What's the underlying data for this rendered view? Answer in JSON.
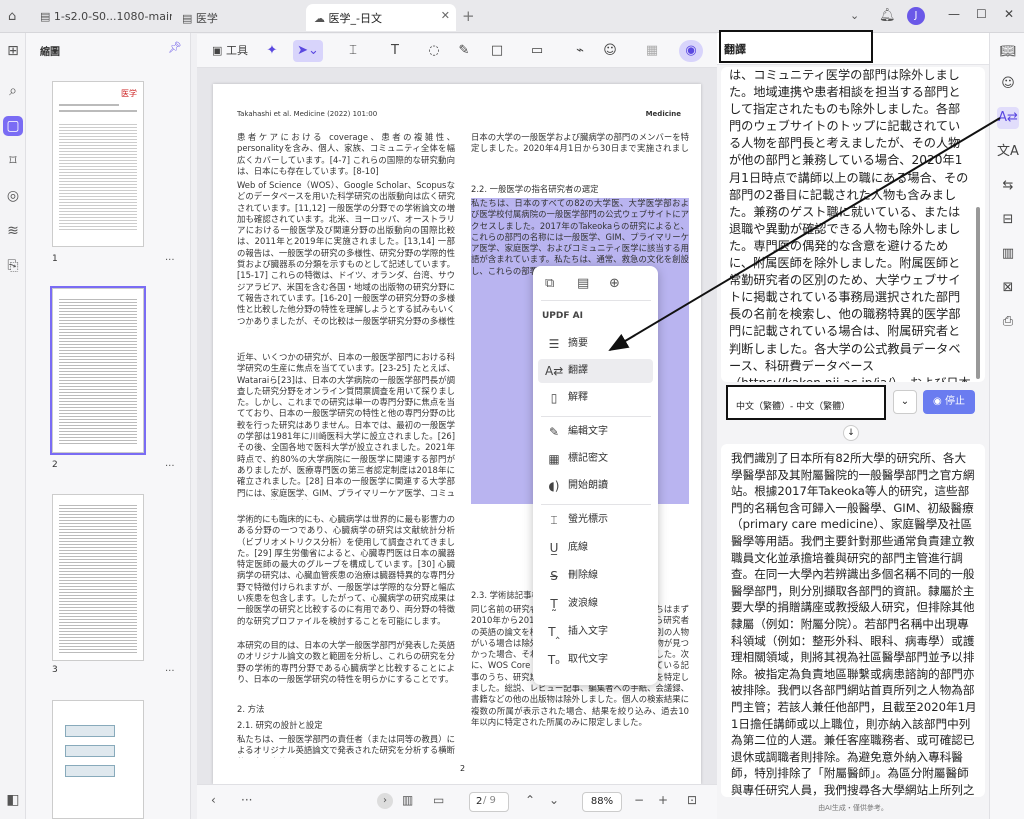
{
  "tabs": [
    {
      "label": "1-s2.0-S0...1080-main"
    },
    {
      "label": "医学"
    },
    {
      "label": "医学_-日文"
    }
  ],
  "window": {
    "avatar": "J"
  },
  "thumbnails": {
    "header": "縮圖",
    "pages": [
      {
        "num": "1"
      },
      {
        "num": "2"
      },
      {
        "num": "3"
      }
    ],
    "more": "..."
  },
  "toolbar": {
    "tools_label": "工具"
  },
  "document": {
    "header_left": "Takahashi et al. Medicine (2022) 101:00",
    "header_right": "Medicine",
    "col_left": [
      "患者ケアにおける coverage、患者の複雑性、personalityを含み、個人、家族、コミュニティ全体を幅広くカバーしています。[4-7] これらの国際的な研究動向は、日本にも存在しています。[8-10]",
      "Web of Science（WOS）、Google Scholar、Scopusなどのデータベースを用いた科学研究の出版動向は広く研究されています。[11,12] 一般医学の分野での学術論文の増加も確認されています。北米、ヨーロッパ、オーストラリアにおける一般医学及び関連分野の出版動向の国際比較は、2011年と2019年に実施されました。[13,14] 一部の報告は、一般医学の研究の多様性、研究分野の学際的性質および臓器系の分類を示すものとして記述しています。[15-17] これらの特徴は、ドイツ、オランダ、台湾、サウジアラビア、米国を含む各国・地域の出版物の研究分野にて報告されています。[16-20] 一般医学の研究分野の多様性と比較した他分野の特性を理解しようとする試みもいくつかありましたが、その比較は一般医学研究分野の多様性に焦点を当てていませんでした。[21,22]",
      "近年、いくつかの研究が、日本の一般医学部門における科学研究の生産に焦点を当てています。[23-25] たとえば、Wataraiら[23]は、日本の大学病院の一般医学部門長が調査した研究分野をオンライン質問票調査を用いて探りました。しかし、これまでの研究は単一の専門分野に焦点を当てており、日本の一般医学研究の特性と他の専門分野の比較を行った研究はありません。日本では、最初の一般医学の学部は1981年に川崎医科大学に設立されました。[26] その後、全国各地で医科大学が設立されました。2021年時点で、約80%の大学病院に一般医学に関連する部門がありましたが、医療専門医の第三者認定制度は2018年に確立されました。[28] 日本の一般医学に関連する大学部門には、家庭医学、GIM、プライマリーケア医学、コミュニティ医学などが含まれます。[27]",
      "学術的にも臨床的にも、心臓病学は世界的に最も影響力のある分野の一つであり、心臓病学の研究は文献統計分析（ビブリオメトリクス分析）を使用して調査されてきました。[29] 厚生労働省によると、心臓専門医は日本の臓器特定医師の最大のグループを構成しています。[30] 心臓病学の研究は、心臓血管疾患の治療は臓器特異的な専門分野で特徴付けられますが、一般医学は学際的な分野と幅広い疾患を包含します。したがって、心臓病学の研究成果は一般医学の研究と比較するのに有用であり、両分野の特徴的な研究プロファイルを検討することを可能にします。",
      "本研究の目的は、日本の大学一般医学部門が発表した英語のオリジナル論文の数と範囲を分析し、これらの研究を分野の学術的専門分野である心臓病学と比較することにより、日本の一般医学研究の特性を明らかにすることです。",
      "2. 方法",
      "2.1. 研究の設計と設定",
      "私たちは、一般医学部門の責任者（または同等の教員）によるオリジナル英語論文で発表された研究を分析する横断的研究を実施しました。"
    ],
    "col_right_top": "日本の大学の一般医学および臓病学の部門のメンバーを特定しました。2020年4月1日から30日まで実施されました。",
    "col_right_h": "2.2. 一般医学の指名研究者の選定",
    "col_right_sel": "私たちは、日本のすべての82の大学医、大学医学部および医学校付属病院の一般医学部門の公式ウェブサイトにアクセスしました。2017年のTakeokaらの研究によると、これらの部門の名称には一般医学、GIM、プライマリーケア医学、家庭医学、およびコミュニティ医学に該当する用語が含まれています。私たちは、通常、救急の文化を創設し、これらの部署は交付されています。",
    "col_right_bottom_h": "2.3. 学術誌記事検索",
    "col_right_bottom": "同じ名前の研究者による重複を避けるため、私たちはまず2010年から2019年までのWOSデータベースから研究者の英語の論文を検索しました。また、同じ名前の別の人物がいる場合は除外しました。次に、その同名の人物が見つかった場合、それぞれの研究者によって区別しました。次に、WOS Core Collection（WOS）に登録されている記事のうち、研究期間に発表されたオリジナル記事を特定しました。総説、レビュー記事、編集者への手紙、会議録、書籍などの他の出版物は除外しました。個人の検索結果に複数の所属が表示された場合、結果を絞り込み、過去10年以内に特定された所属のみに限定しました。",
    "page_num": "2"
  },
  "context_menu": {
    "section_label": "UPDF AI",
    "items": [
      {
        "icon": "summary-icon",
        "label": "摘要"
      },
      {
        "icon": "translate-icon",
        "label": "翻譯"
      },
      {
        "icon": "explain-icon",
        "label": "解釋"
      },
      {
        "icon": "edit-text-icon",
        "label": "編輯文字"
      },
      {
        "icon": "mark-secret-icon",
        "label": "標記密文"
      },
      {
        "icon": "read-aloud-icon",
        "label": "開始朗讀"
      },
      {
        "icon": "highlight-icon",
        "label": "螢光標示"
      },
      {
        "icon": "underline-icon",
        "label": "底線"
      },
      {
        "icon": "strikethrough-icon",
        "label": "刪除線"
      },
      {
        "icon": "squiggly-icon",
        "label": "波浪線"
      },
      {
        "icon": "insert-text-icon",
        "label": "插入文字"
      },
      {
        "icon": "replace-text-icon",
        "label": "取代文字"
      }
    ]
  },
  "bottombar": {
    "page_current": "2",
    "page_total": "/ 9",
    "zoom": "88%"
  },
  "right_panel": {
    "title": "翻譯",
    "source_text": "は、コミュニティ医学の部門は除外しました。地域連携や患者相談を担当する部門として指定されたものも除外しました。各部門のウェブサイトのトップに記載されている人物を部門長と考えましたが、その人物が他の部門と兼務している場合、2020年1月1日時点で講師以上の職にある場合、その部門の2番目に記載された人物も含みました。兼務のゲスト職に就いている、または退職や異動が確認できる人物も除外しました。専門医の偶発的な含意を避けるために、附属医師を除外しました。附属医師と常勤研究者の区別のため、大学ウェブサイトに掲載されている事務局選択された部門長の名前を検索し、他の職務特異的医学部門に記載されている場合は、附属研究者と判断しました。各大学の公式教員データベース、科研費データベース（https://kaken.nii.ac.jp/ja/）、および日本学術振興会が運営するResearchmap（https://researchmap.jp）を用いて、各対象者の背景情報を確認しました。背景が不明な場合は、個々の研究者やその所属部門によって作成された私設のウェブサイトも使用しました。",
    "language": "中文（繁體）- 中文（繁體）",
    "stop_label": "停止",
    "output_text": "我們識別了日本所有82所大學的研究所、各大學醫學部及其附屬醫院的一般醫學部門之官方網站。根據2017年Takeoka等人的研究，這些部門的名稱包含可歸入一般醫學、GIM、初級醫療（primary care medicine）、家庭醫學及社區醫學等用語。我們主要針對那些通常負責建立教職員文化並承擔培養與研究的部門主管進行調查。在同一大學內若辨識出多個名稱不同的一般醫學部門，則分別擷取各部門的資訊。隸屬於主要大學的捐贈講座或教授級人研究，但排除其他隸屬（例如：附屬分院）。若部門名稱中出現專科領域（例如：整形外科、眼科、病毒學）或護理相關領域，則將其視為社區醫學部門並予以排除。被指定為負責地區聯繫或病患諮詢的部門亦被排除。我們以各部門網站首頁所列之人物為部門主管；若該人兼任他部門，且截至2020年1月1日擔任講師或以上職位，則亦納入該部門中列為第二位的人選。兼任客座職務者、或可確認已退休或調職者則排除。為避免意外納入專科醫師，特別排除了「附屬醫師」。為區分附屬醫師與專任研究人員，我們搜尋各大學網站上所列之每位預選部門主管的姓名，若該姓名同時出現在其他臟",
    "footnote": "由AI生成・僅供參考。"
  }
}
